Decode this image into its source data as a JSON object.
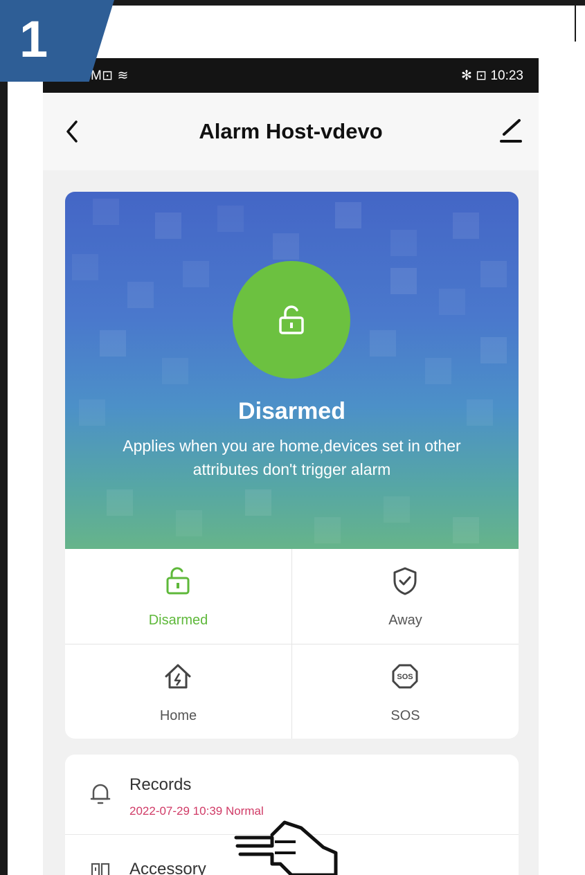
{
  "step": {
    "number": "1"
  },
  "status_bar": {
    "left": "SIM⊡ ≋",
    "right": "✻ ⊡ 10:23"
  },
  "nav": {
    "title": "Alarm Host-vdevo"
  },
  "hero": {
    "state": "Disarmed",
    "description": "Applies when you are home,devices set in other attributes  don't trigger alarm"
  },
  "modes": [
    {
      "label": "Disarmed",
      "icon": "unlock-icon",
      "active": true
    },
    {
      "label": "Away",
      "icon": "shield-check-icon",
      "active": false
    },
    {
      "label": "Home",
      "icon": "home-bolt-icon",
      "active": false
    },
    {
      "label": "SOS",
      "icon": "sos-icon",
      "active": false
    }
  ],
  "list": {
    "records": {
      "title": "Records",
      "subtitle": "2022-07-29 10:39 Normal"
    },
    "accessory": {
      "title": "Accessory"
    }
  },
  "colors": {
    "accent_green": "#6cc140",
    "active_label": "#5eb83a",
    "record_status": "#d03a66",
    "step_badge": "#2e5e96"
  }
}
